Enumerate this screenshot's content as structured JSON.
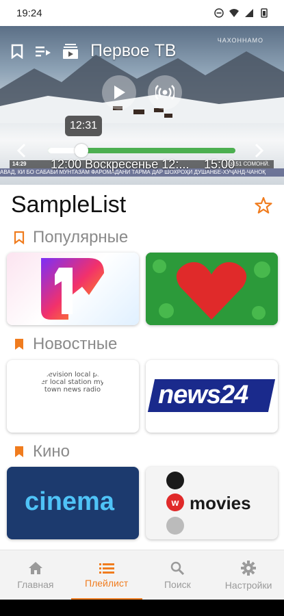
{
  "status": {
    "time": "19:24"
  },
  "player": {
    "channel_title": "Первое ТВ",
    "watermark": "ЧАХОННАМО",
    "seek_time": "12:31",
    "progress_fraction": 0.18,
    "epg_text": "12:00 Воскресенье 12:...",
    "epg_end": "15:00",
    "ticker_time": "14:29",
    "ticker_text": "...3151 СОМОНӢ.",
    "ticker_line2": "АВАД, КИ БО САБАБИ МУНТАЗАМ ФАРОМАДАНИ ТАРМА ДАР ШОХРОҲИ ДУШАНБЕ-ХУҶАНД-ЧАНОҚ"
  },
  "playlist": {
    "title": "SampleList"
  },
  "sections": [
    {
      "label": "Популярные"
    },
    {
      "label": "Новостные"
    },
    {
      "label": "Кино"
    }
  ],
  "cards": {
    "news24_text": "news24",
    "cinema_text": "cinema",
    "wmovies_text": "movies",
    "mytown_words": "television local paper local station my town news radio"
  },
  "nav": [
    {
      "label": "Главная",
      "icon": "home-icon"
    },
    {
      "label": "Плейлист",
      "icon": "list-icon"
    },
    {
      "label": "Поиск",
      "icon": "search-icon"
    },
    {
      "label": "Настройки",
      "icon": "gear-icon"
    }
  ],
  "colors": {
    "accent": "#f07c1e",
    "progress": "#4caf50"
  }
}
